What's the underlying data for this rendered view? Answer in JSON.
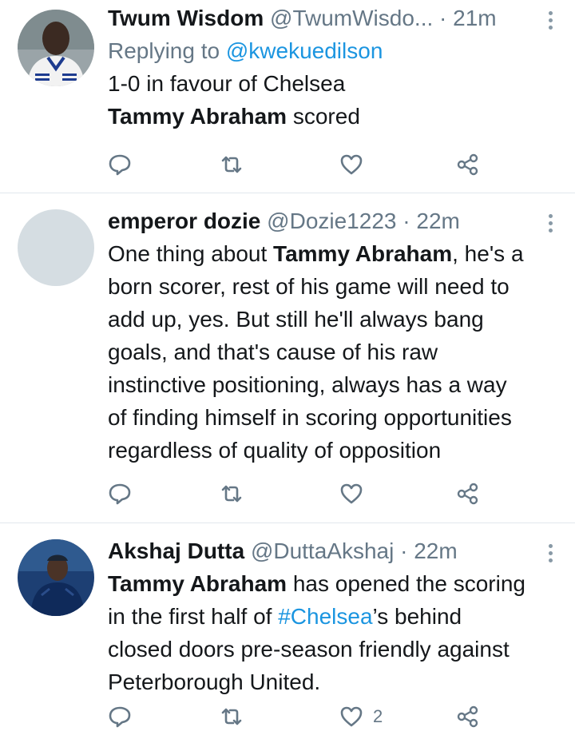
{
  "tweets": [
    {
      "name": "Twum Wisdom",
      "handle": "@TwumWisdo...",
      "sep": " ·",
      "time": "21m",
      "reply_prefix": "Replying to ",
      "reply_handle": "@kwekuedilson",
      "line1": "1-0 in favour of Chelsea",
      "line2_bold": "Tammy Abraham",
      "line2_rest": " scored",
      "likes": ""
    },
    {
      "name": "emperor dozie",
      "handle": "@Dozie1223",
      "sep": " · ",
      "time": "22m",
      "l1_a": "One thing about ",
      "l1_bold": "Tammy Abraham",
      "l1_b": ", he's a",
      "l2": "born scorer, rest of his game will need to",
      "l3": "add up, yes. But still he'll always bang",
      "l4": "goals, and that's cause of his raw",
      "l5": "instinctive positioning, always has a way",
      "l6": "of finding himself in scoring opportunities",
      "l7": "regardless of quality of opposition",
      "likes": ""
    },
    {
      "name": "Akshaj Dutta",
      "handle": "@DuttaAkshaj",
      "sep": " · ",
      "time": "22m",
      "l1_bold": "Tammy Abraham",
      "l1_rest": " has opened the scoring",
      "l2_a": "in the first half of ",
      "l2_link": "#Chelsea",
      "l2_b": "’s behind",
      "l3": "closed doors pre-season friendly against",
      "l4": "Peterborough United.",
      "likes": "2"
    }
  ],
  "icons": {
    "reply": "reply-icon",
    "retweet": "retweet-icon",
    "like": "heart-icon",
    "share": "share-icon",
    "more": "more-options-icon"
  },
  "colors": {
    "text": "#14171a",
    "muted": "#657786",
    "link": "#1b95e0",
    "divider": "#e1e8ed"
  }
}
